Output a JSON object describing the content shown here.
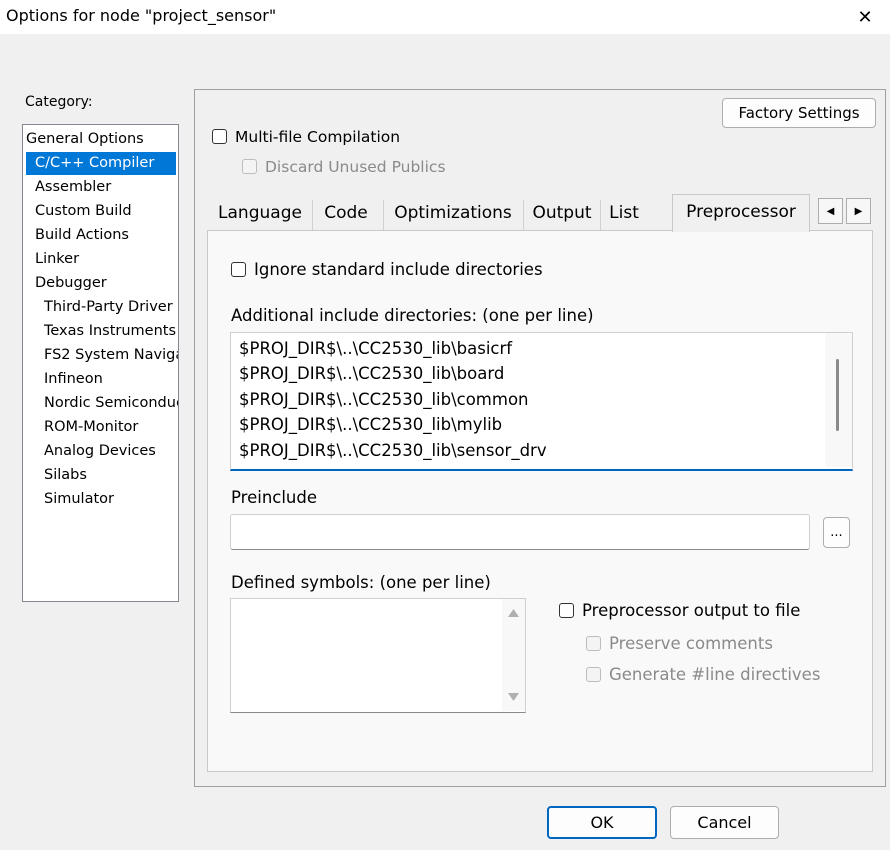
{
  "window": {
    "title": "Options for node \"project_sensor\"",
    "close_glyph": "✕"
  },
  "category": {
    "label": "Category:",
    "items": [
      "General Options",
      "C/C++ Compiler",
      "Assembler",
      "Custom Build",
      "Build Actions",
      "Linker",
      "Debugger",
      "Third-Party Driver",
      "Texas Instruments",
      "FS2 System Naviga",
      "Infineon",
      "Nordic Semiconduc",
      "ROM-Monitor",
      "Analog Devices",
      "Silabs",
      "Simulator"
    ],
    "selected": "C/C++ Compiler"
  },
  "panel": {
    "factory_settings": "Factory Settings",
    "multi_file": "Multi-file Compilation",
    "discard_unused": "Discard Unused Publics"
  },
  "tabs": {
    "items": [
      "Language",
      "Code",
      "Optimizations",
      "Output",
      "List",
      "Preprocessor"
    ],
    "active": "Preprocessor",
    "left_arrow": "◀",
    "right_arrow": "▶"
  },
  "preprocessor": {
    "ignore_std": "Ignore standard include directories",
    "additional_label": "Additional include directories: (one per line)",
    "include_dirs": [
      "$PROJ_DIR$\\..\\CC2530_lib\\basicrf",
      "$PROJ_DIR$\\..\\CC2530_lib\\board",
      "$PROJ_DIR$\\..\\CC2530_lib\\common",
      "$PROJ_DIR$\\..\\CC2530_lib\\mylib",
      "$PROJ_DIR$\\..\\CC2530_lib\\sensor_drv"
    ],
    "preinclude_label": "Preinclude",
    "preinclude_value": "",
    "browse_label": "...",
    "defined_label": "Defined symbols: (one per line)",
    "defined_value": "",
    "output_to_file": "Preprocessor output to file",
    "preserve_comments": "Preserve comments",
    "generate_line": "Generate #line directives"
  },
  "footer": {
    "ok": "OK",
    "cancel": "Cancel"
  }
}
